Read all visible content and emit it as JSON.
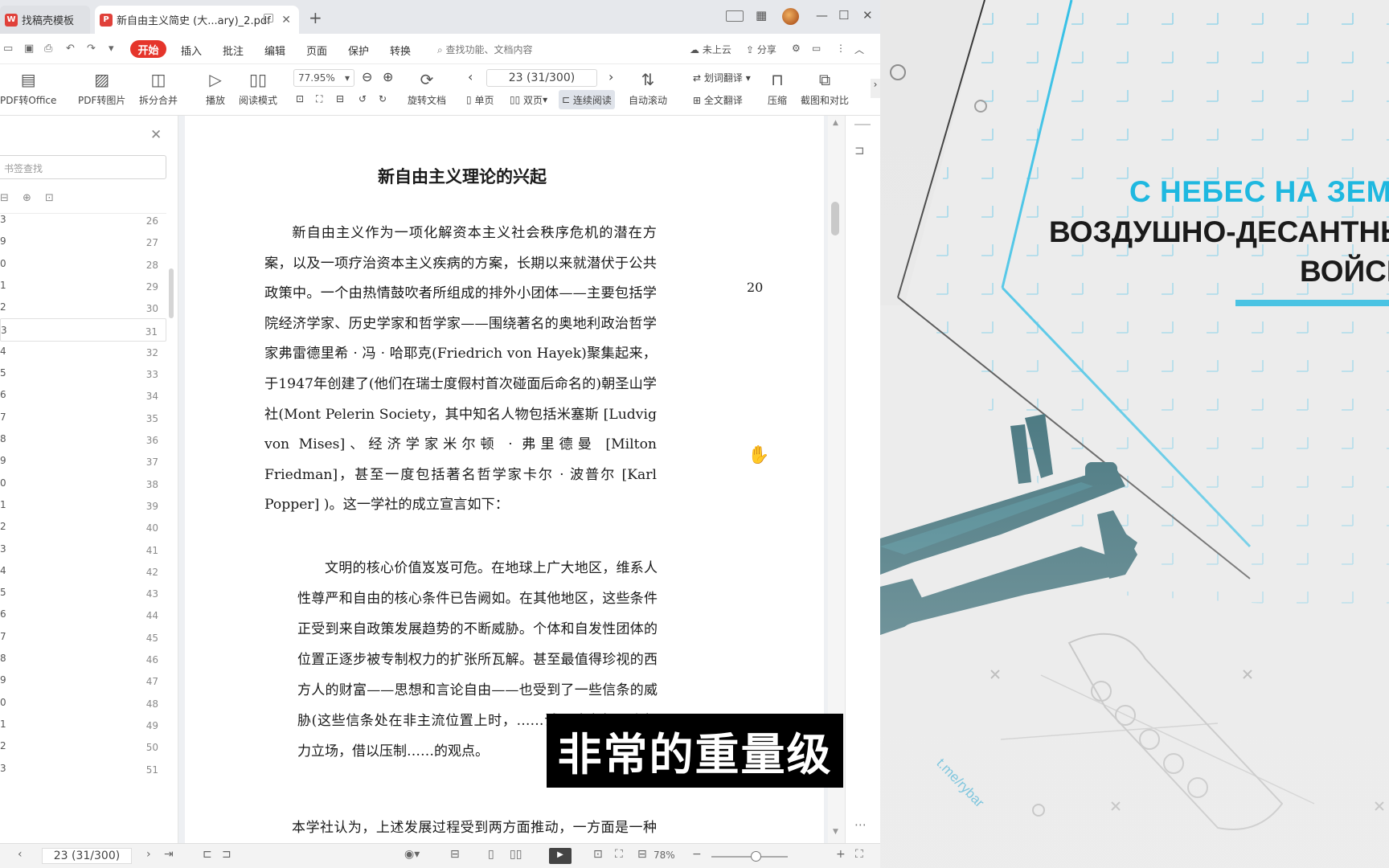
{
  "tabs": [
    {
      "label": "找稿壳模板"
    },
    {
      "label": "新自由主义简史 (大...ary)_2.pdf"
    }
  ],
  "menu": {
    "start": "开始",
    "items": [
      "插入",
      "批注",
      "编辑",
      "页面",
      "保护",
      "转换"
    ],
    "search": "查找功能、文档内容",
    "cloud": "未上云",
    "share": "分享"
  },
  "toolbar": {
    "pdf_office": "PDF转Office",
    "pdf_image": "PDF转图片",
    "split": "拆分合并",
    "play": "播放",
    "read_mode": "阅读模式",
    "zoom": "77.95%",
    "rotate_doc": "旋转文档",
    "page": "23 (31/300)",
    "single": "单页",
    "double": "双页",
    "continuous": "连续阅读",
    "auto_scroll": "自动滚动",
    "word_translate": "划词翻译",
    "full_translate": "全文翻译",
    "compress": "压缩",
    "screenshot": "截图和对比"
  },
  "sidebar": {
    "search_placeholder": "书签查找",
    "rows": [
      {
        "l": "3",
        "n": "26"
      },
      {
        "l": "9",
        "n": "27"
      },
      {
        "l": "0",
        "n": "28"
      },
      {
        "l": "1",
        "n": "29"
      },
      {
        "l": "2",
        "n": "30"
      },
      {
        "l": "3",
        "n": "31"
      },
      {
        "l": "4",
        "n": "32"
      },
      {
        "l": "5",
        "n": "33"
      },
      {
        "l": "6",
        "n": "34"
      },
      {
        "l": "7",
        "n": "35"
      },
      {
        "l": "8",
        "n": "36"
      },
      {
        "l": "9",
        "n": "37"
      },
      {
        "l": "0",
        "n": "38"
      },
      {
        "l": "1",
        "n": "39"
      },
      {
        "l": "2",
        "n": "40"
      },
      {
        "l": "3",
        "n": "41"
      },
      {
        "l": "4",
        "n": "42"
      },
      {
        "l": "5",
        "n": "43"
      },
      {
        "l": "6",
        "n": "44"
      },
      {
        "l": "7",
        "n": "45"
      },
      {
        "l": "8",
        "n": "46"
      },
      {
        "l": "9",
        "n": "47"
      },
      {
        "l": "0",
        "n": "48"
      },
      {
        "l": "1",
        "n": "49"
      },
      {
        "l": "2",
        "n": "50"
      },
      {
        "l": "3",
        "n": "51"
      }
    ]
  },
  "document": {
    "title": "新自由主义理论的兴起",
    "margin_number": "20",
    "paragraph1": "新自由主义作为一项化解资本主义社会秩序危机的潜在方案，以及一项疗治资本主义疾病的方案，长期以来就潜伏于公共政策中。一个由热情鼓吹者所组成的排外小团体——主要包括学院经济学家、历史学家和哲学家——围绕著名的奥地利政治哲学家弗雷德里希 · 冯 · 哈耶克(Friedrich von Hayek)聚集起来，于1947年创建了(他们在瑞士度假村首次碰面后命名的)朝圣山学社(Mont Pelerin Society，其中知名人物包括米塞斯 [Ludvig von Mises]、经济学家米尔顿 · 弗里德曼 [Milton Friedman]，甚至一度包括著名哲学家卡尔 · 波普尔 [Karl Popper] )。这一学社的成立宣言如下：",
    "quote": "文明的核心价值岌岌可危。在地球上广大地区，维系人性尊严和自由的核心条件已告阙如。在其他地区，这些条件正受到来自政策发展趋势的不断威胁。个体和自发性团体的位置正逐步被专制权力的扩张所瓦解。甚至最值得珍视的西方人的财富——思想和言论自由——也受到了一些信条的威胁(这些信条处在非主流位置上时，……试图建立起一个权力立场，借以压制……的观点。",
    "paragraph2": "本学社认为，上述发展过程受到两方面推动，一方面是一种否认一切绝对道德标准的历史观的发展，另一方面是那"
  },
  "subtitle": "非常的重量级",
  "status": {
    "page": "23 (31/300)",
    "zoom": "78%"
  },
  "video": {
    "line1": "С НЕБЕС НА ЗЕМЛ",
    "line2": "ВОЗДУШНО-ДЕСАНТНЫ",
    "line3": "ВОЙСК",
    "watermark": "t.me/rybar"
  },
  "colors": {
    "accent": "#e5352b",
    "cyan": "#1fb8e0"
  }
}
